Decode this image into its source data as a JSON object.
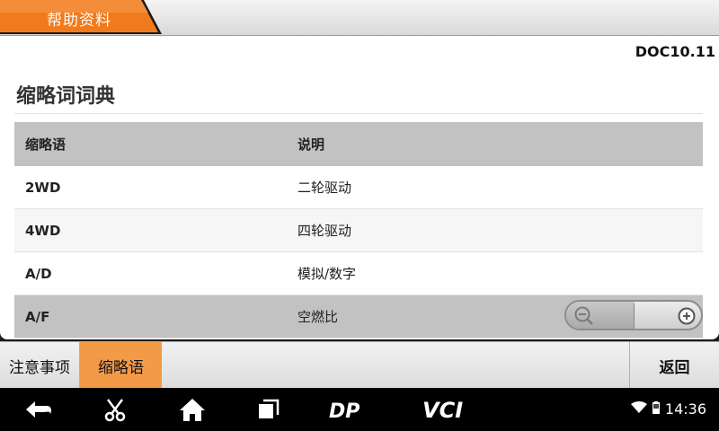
{
  "header": {
    "title": "帮助资料",
    "accent": "#f07a1c"
  },
  "document": {
    "code": "DOC10.11",
    "title": "缩略词词典",
    "columns": [
      "缩略语",
      "说明"
    ],
    "rows": [
      {
        "abbr": "2WD",
        "desc": "二轮驱动"
      },
      {
        "abbr": "4WD",
        "desc": "四轮驱动"
      },
      {
        "abbr": "A/D",
        "desc": "模拟/数字"
      },
      {
        "abbr": "A/F",
        "desc": "空燃比"
      }
    ]
  },
  "zoom": {
    "out_icon": "zoom-out-icon",
    "in_icon": "zoom-in-icon"
  },
  "tabs": {
    "notice": "注意事项",
    "abbr": "缩略语",
    "back": "返回",
    "active_color": "#f39a49"
  },
  "navbar": {
    "icons": [
      "back-arrow-icon",
      "scissors-icon",
      "home-icon",
      "recents-icon",
      "dp-logo",
      "vci-logo"
    ],
    "dp_label": "DP",
    "vci_label": "VCI",
    "time": "14:36"
  }
}
